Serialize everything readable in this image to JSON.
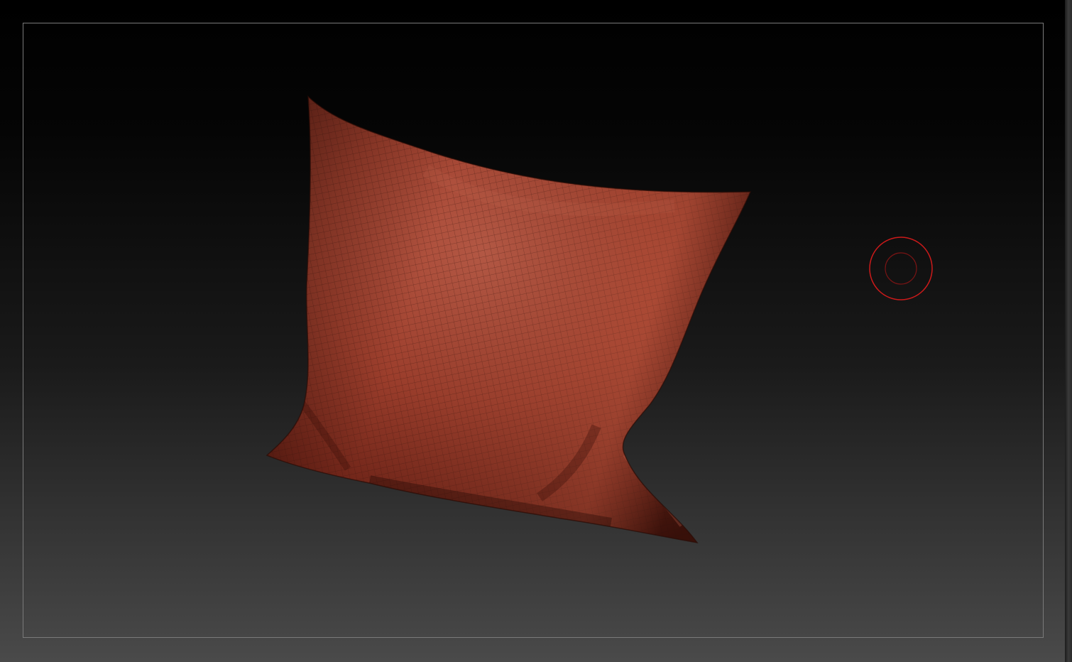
{
  "viewport": {
    "background_top": "#000000",
    "background_bottom": "#4a4a4a",
    "frame_color": "#7a7a7a"
  },
  "model": {
    "name": "pillow",
    "material_color": "#a84a38",
    "wireframe_color": "#3a140c",
    "polyframe": true
  },
  "brush_cursor": {
    "icon": "brush-cursor-icon",
    "color": "#cc1a1a"
  }
}
